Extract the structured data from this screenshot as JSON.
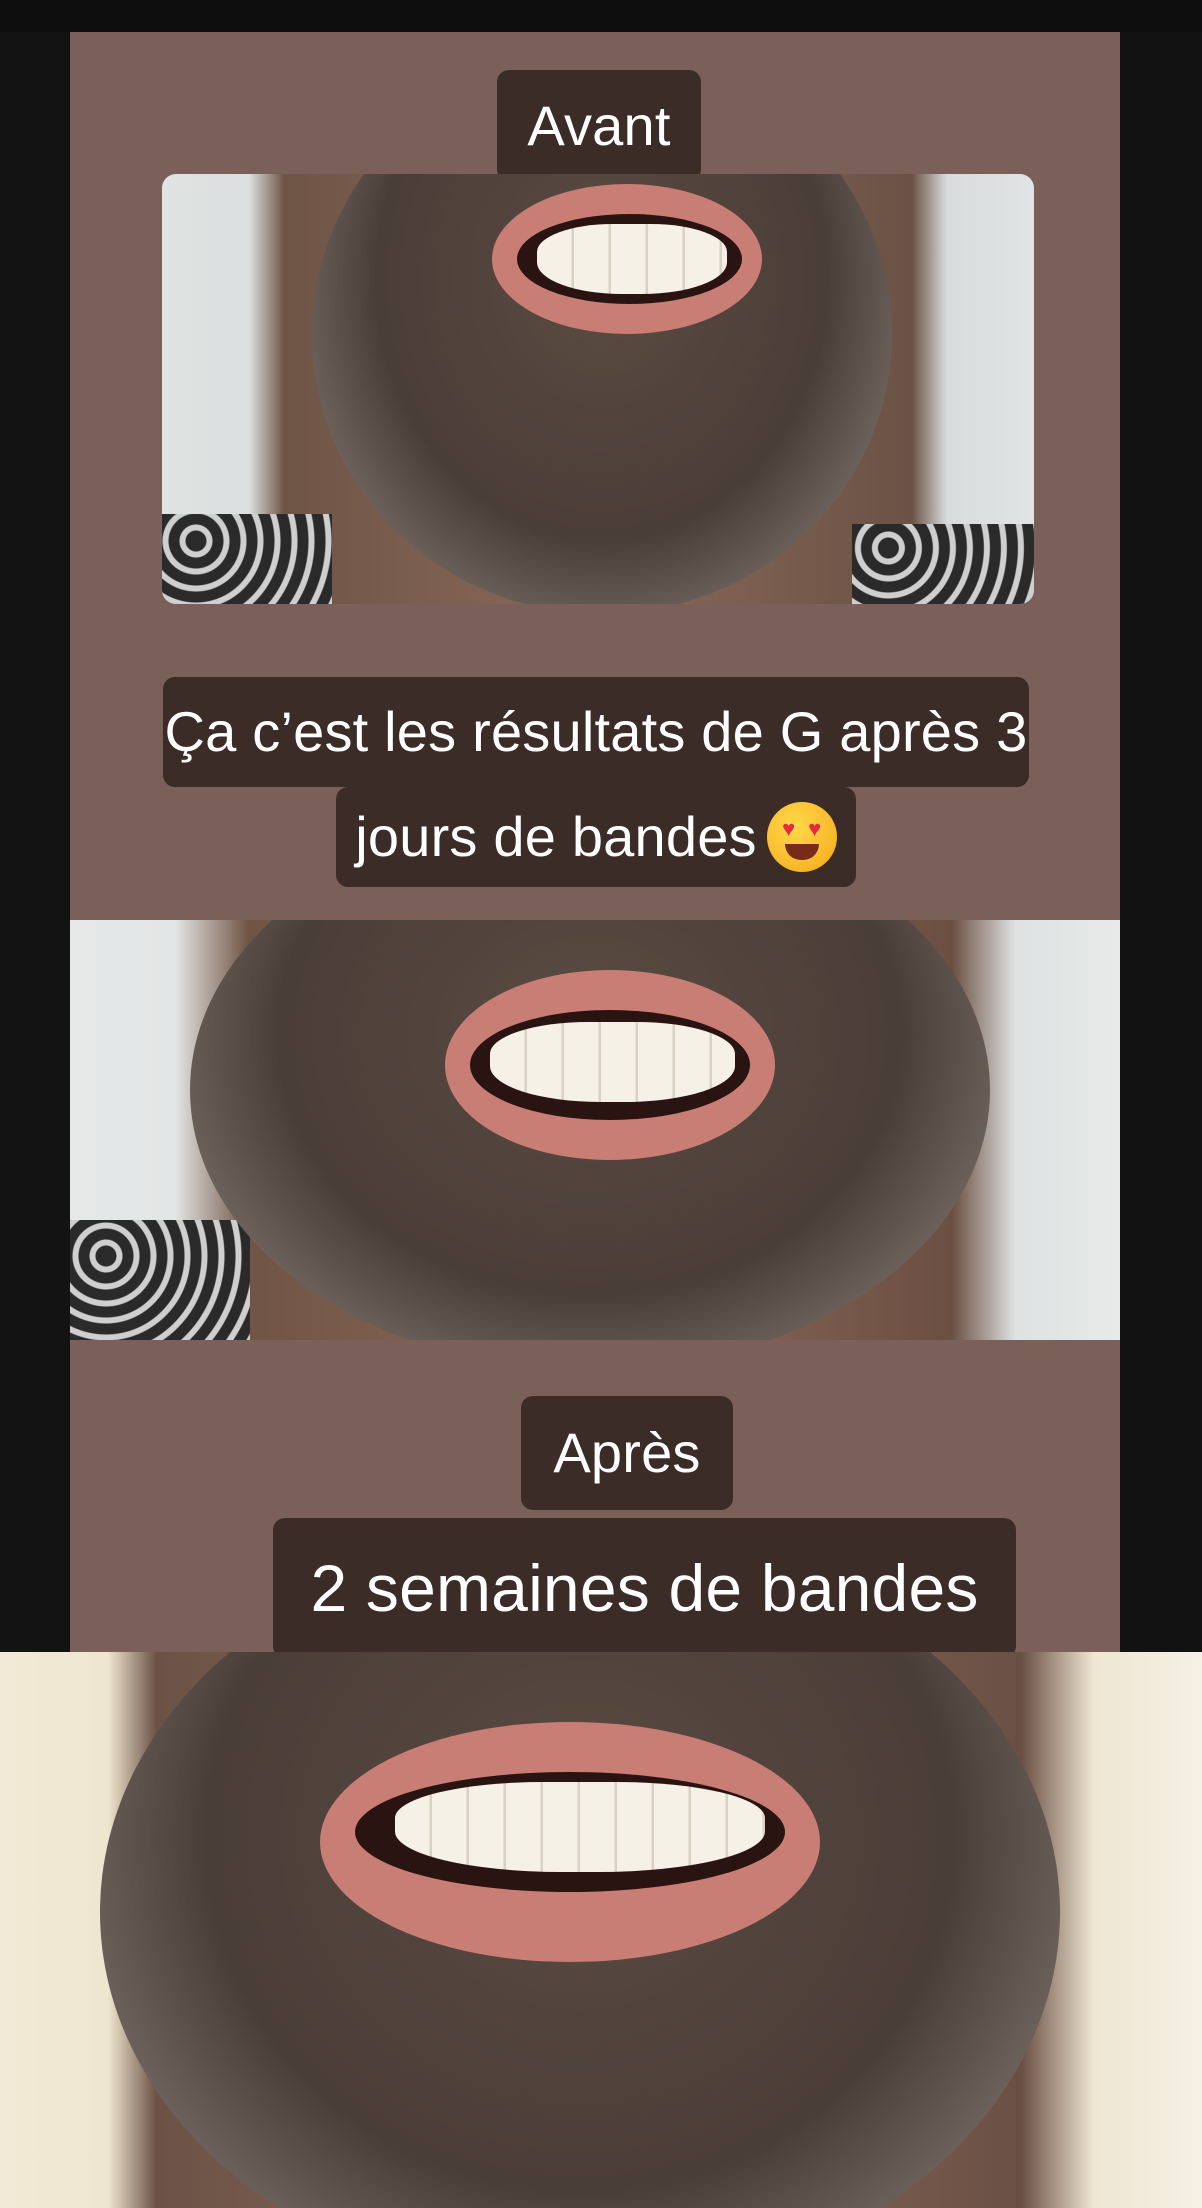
{
  "story": {
    "before_label": "Avant",
    "caption_line1": "Ça c’est les résultats de G après 3",
    "caption_line2": "jours de bandes",
    "caption_emoji": "smiling-face-with-heart-eyes-icon",
    "after_label": "Après",
    "after_duration": "2 semaines de bandes"
  },
  "colors": {
    "card_background": "#7b6059",
    "label_background": "#3b2c28",
    "label_text": "#ffffff",
    "page_background": "#0e0e0e"
  }
}
